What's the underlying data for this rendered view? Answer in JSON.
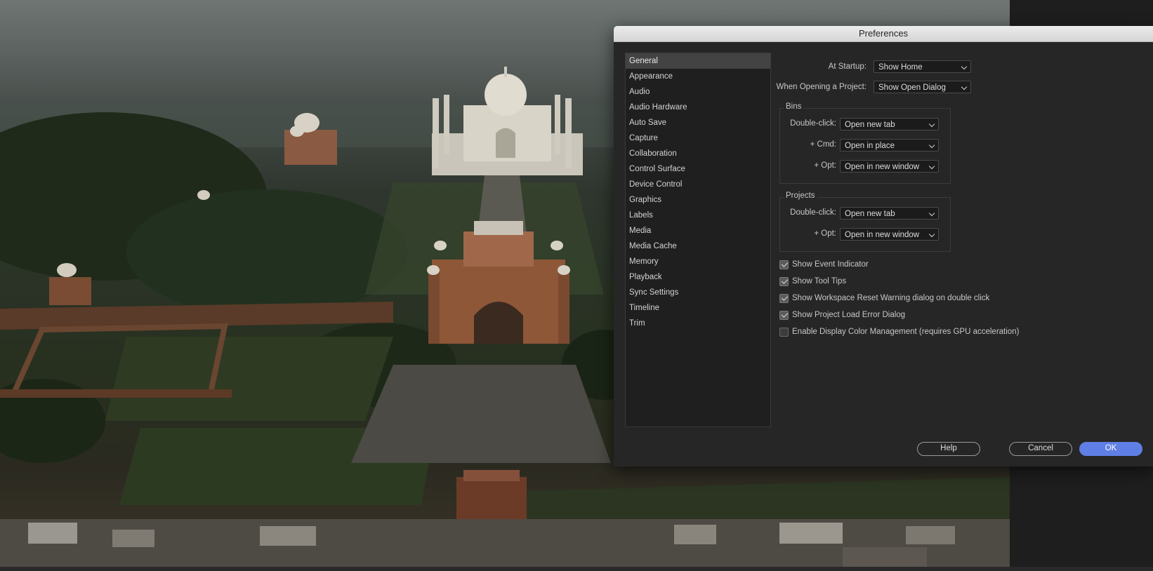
{
  "dialog": {
    "title": "Preferences"
  },
  "sidebar": {
    "items": [
      {
        "label": "General",
        "active": true
      },
      {
        "label": "Appearance"
      },
      {
        "label": "Audio"
      },
      {
        "label": "Audio Hardware"
      },
      {
        "label": "Auto Save"
      },
      {
        "label": "Capture"
      },
      {
        "label": "Collaboration"
      },
      {
        "label": "Control Surface"
      },
      {
        "label": "Device Control"
      },
      {
        "label": "Graphics"
      },
      {
        "label": "Labels"
      },
      {
        "label": "Media"
      },
      {
        "label": "Media Cache"
      },
      {
        "label": "Memory"
      },
      {
        "label": "Playback"
      },
      {
        "label": "Sync Settings"
      },
      {
        "label": "Timeline"
      },
      {
        "label": "Trim"
      }
    ]
  },
  "general": {
    "startup_label": "At Startup:",
    "startup_value": "Show Home",
    "opening_label": "When Opening a Project:",
    "opening_value": "Show Open Dialog"
  },
  "bins": {
    "title": "Bins",
    "double_click_label": "Double-click:",
    "double_click_value": "Open new tab",
    "cmd_label": "+ Cmd:",
    "cmd_value": "Open in place",
    "opt_label": "+ Opt:",
    "opt_value": "Open in new window"
  },
  "projects": {
    "title": "Projects",
    "double_click_label": "Double-click:",
    "double_click_value": "Open new tab",
    "opt_label": "+ Opt:",
    "opt_value": "Open in new window"
  },
  "checkboxes": [
    {
      "label": "Show Event Indicator",
      "checked": true
    },
    {
      "label": "Show Tool Tips",
      "checked": true
    },
    {
      "label": "Show Workspace Reset Warning dialog on double click",
      "checked": true
    },
    {
      "label": "Show Project Load Error Dialog",
      "checked": true
    },
    {
      "label": "Enable Display Color Management (requires GPU acceleration)",
      "checked": false
    }
  ],
  "buttons": {
    "help": "Help",
    "cancel": "Cancel",
    "ok": "OK"
  },
  "colors": {
    "accent": "#5f7fe6",
    "dialog_bg": "#262626",
    "sidebar_active": "#434343"
  }
}
